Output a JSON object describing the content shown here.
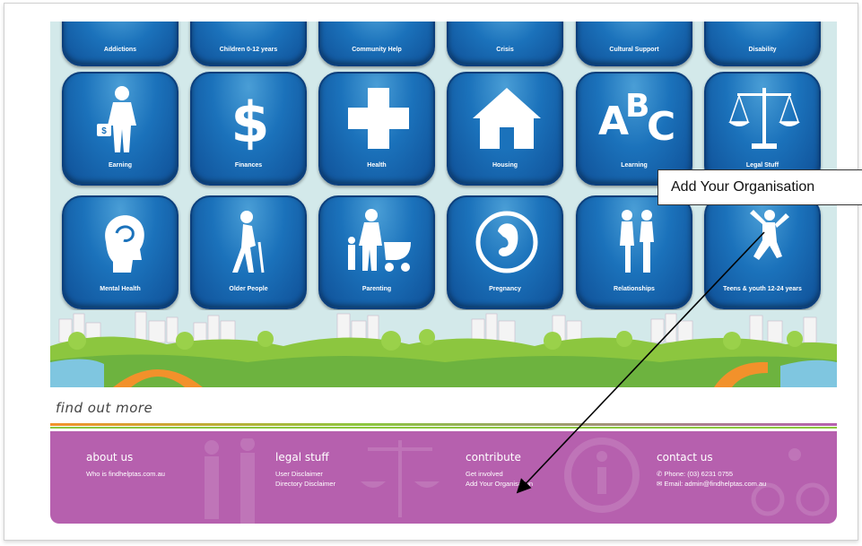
{
  "tiles_top_row": [
    "Addictions",
    "Children 0-12 years",
    "Community Help",
    "Crisis",
    "Cultural Support",
    "Disability"
  ],
  "tiles_row2": [
    {
      "label": "Earning",
      "icon": "businessman-icon"
    },
    {
      "label": "Finances",
      "icon": "dollar-icon"
    },
    {
      "label": "Health",
      "icon": "medical-cross-icon"
    },
    {
      "label": "Housing",
      "icon": "house-icon"
    },
    {
      "label": "Learning",
      "icon": "abc-icon"
    },
    {
      "label": "Legal Stuff",
      "icon": "scales-icon"
    }
  ],
  "tiles_row3": [
    {
      "label": "Mental Health",
      "icon": "head-icon"
    },
    {
      "label": "Older People",
      "icon": "elderly-walking-icon"
    },
    {
      "label": "Parenting",
      "icon": "parent-pram-icon"
    },
    {
      "label": "Pregnancy",
      "icon": "fetus-icon"
    },
    {
      "label": "Relationships",
      "icon": "couple-icon"
    },
    {
      "label": "Teens & youth 12-24 years",
      "icon": "jumping-teen-icon"
    }
  ],
  "find_out_more": "find out more",
  "footer": {
    "about": {
      "heading": "about us",
      "links": [
        "Who is findhelptas.com.au"
      ]
    },
    "legal": {
      "heading": "legal stuff",
      "links": [
        "User Disclaimer",
        "Directory Disclaimer"
      ]
    },
    "contribute": {
      "heading": "contribute",
      "links": [
        "Get involved",
        "Add Your Organisation"
      ]
    },
    "contact": {
      "heading": "contact us",
      "phone": "Phone: (03) 6231 0755",
      "email": "Email: admin@findhelptas.com.au"
    }
  },
  "callout_text": "Add Your Organisation",
  "colors": {
    "tile_blue": "#1b72bb",
    "footer_purple": "#b660ae",
    "sky": "#d3e9ea"
  }
}
